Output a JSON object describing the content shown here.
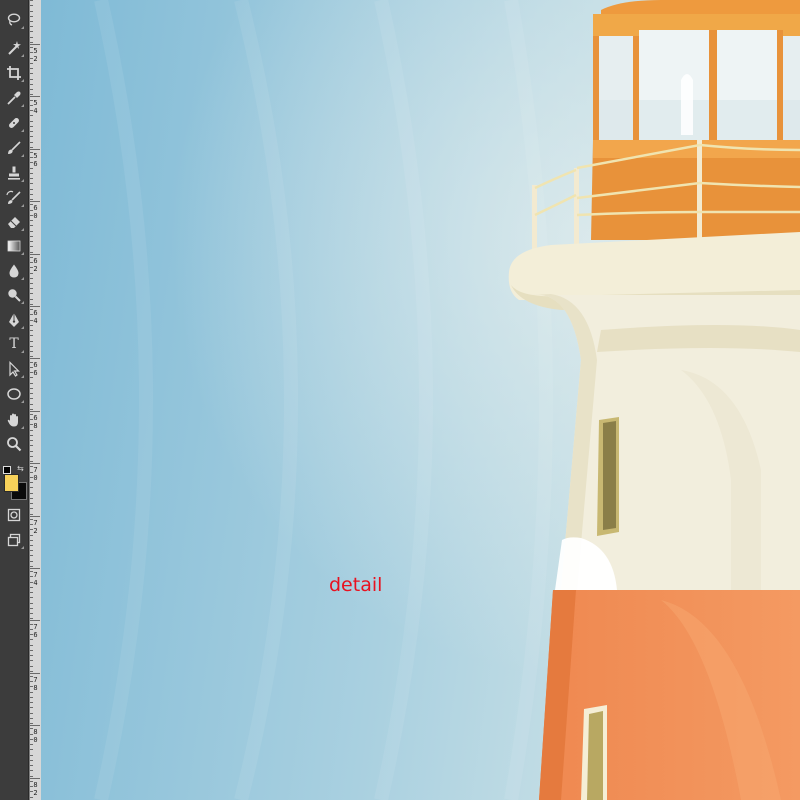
{
  "canvas": {
    "annotation_text": "detail",
    "annotation_color": "#e8111f",
    "sky_color_left": "#7fbad6",
    "sky_color_right": "#d4e6e8"
  },
  "toolbar": {
    "tools": [
      {
        "name": "lasso-tool",
        "icon": "lasso-icon"
      },
      {
        "name": "quick-selection-tool",
        "icon": "magic-wand-icon"
      },
      {
        "name": "crop-tool",
        "icon": "crop-icon"
      },
      {
        "name": "eyedropper-tool",
        "icon": "eyedropper-icon"
      },
      {
        "name": "healing-brush-tool",
        "icon": "bandage-icon"
      },
      {
        "name": "brush-tool",
        "icon": "brush-icon"
      },
      {
        "name": "clone-stamp-tool",
        "icon": "stamp-icon"
      },
      {
        "name": "history-brush-tool",
        "icon": "history-brush-icon"
      },
      {
        "name": "eraser-tool",
        "icon": "eraser-icon"
      },
      {
        "name": "gradient-tool",
        "icon": "gradient-icon"
      },
      {
        "name": "blur-tool",
        "icon": "droplet-icon"
      },
      {
        "name": "dodge-tool",
        "icon": "dodge-icon"
      },
      {
        "name": "pen-tool",
        "icon": "pen-icon"
      },
      {
        "name": "type-tool",
        "icon": "type-icon",
        "glyph": "T"
      },
      {
        "name": "path-selection-tool",
        "icon": "arrow-icon"
      },
      {
        "name": "ellipse-tool",
        "icon": "ellipse-icon"
      },
      {
        "name": "hand-tool",
        "icon": "hand-icon"
      },
      {
        "name": "zoom-tool",
        "icon": "zoom-icon"
      }
    ],
    "foreground_color": "#f8d25a",
    "background_color": "#0a0a0a"
  },
  "ruler": {
    "labels": [
      "5",
      "5",
      "5",
      "6",
      "6",
      "6",
      "6",
      "6",
      "7",
      "7",
      "7",
      "7",
      "7",
      "8",
      "8"
    ],
    "sublabels": [
      "2",
      "4",
      "6",
      "0",
      "2",
      "4",
      "6",
      "8",
      "0",
      "2",
      "4",
      "6",
      "8",
      "0",
      "2"
    ]
  }
}
